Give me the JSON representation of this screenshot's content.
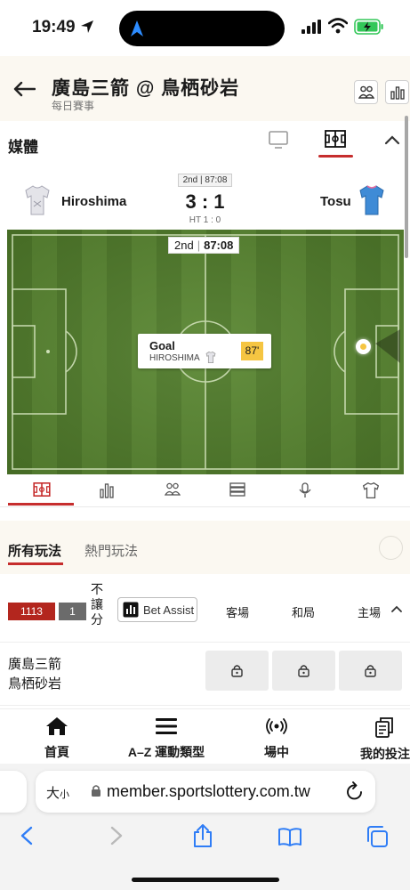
{
  "status_bar": {
    "time": "19:49"
  },
  "header": {
    "title": "廣島三箭 @ 鳥栖砂岩",
    "subtitle": "每日賽事"
  },
  "media": {
    "label": "媒體"
  },
  "scoreboard": {
    "home_team": "Hiroshima",
    "away_team": "Tosu",
    "clock": "2nd | 87:08",
    "score": "3 : 1",
    "halftime": "HT 1 : 0",
    "home_color": "#e4e4e9",
    "away_color": "#3f8bd6"
  },
  "pitch": {
    "period": "2nd",
    "time": "87:08",
    "event": {
      "title": "Goal",
      "team": "HIROSHIMA",
      "minute": "87'"
    }
  },
  "bet_tabs": [
    {
      "label": "所有玩法",
      "active": true
    },
    {
      "label": "熱門玩法",
      "active": false
    }
  ],
  "market": {
    "badge_count": "1113",
    "badge_count_color": "#b3261e",
    "badge_small": "1",
    "badge_small_color": "#6b6b6b",
    "handicap_chars": [
      "不",
      "讓",
      "分"
    ],
    "bet_assist": "Bet Assist",
    "columns": [
      "客場",
      "和局",
      "主場"
    ]
  },
  "match_row": {
    "team1": "廣島三箭",
    "team2": "鳥栖砂岩",
    "odds_locked": [
      true,
      true,
      true
    ]
  },
  "bottom_nav": [
    {
      "label": "首頁",
      "icon": "home-icon"
    },
    {
      "label": "A–Z 運動類型",
      "icon": "menu-icon"
    },
    {
      "label": "場中",
      "icon": "live-signal-icon"
    },
    {
      "label": "我的投注",
      "icon": "documents-icon"
    }
  ],
  "browser": {
    "text_size": "大",
    "text_size_small": "小",
    "url": "member.sportslottery.com.tw"
  },
  "accent_color": "#c62d2d"
}
